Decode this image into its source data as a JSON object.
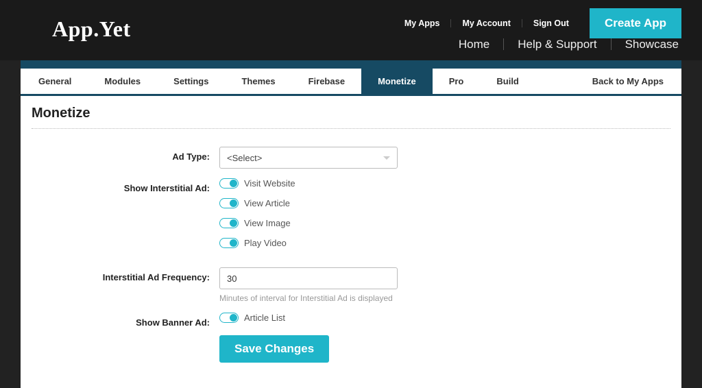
{
  "logo": "App.Yet",
  "top_links": {
    "my_apps": "My Apps",
    "my_account": "My Account",
    "sign_out": "Sign Out"
  },
  "create_app": "Create App",
  "main_nav": {
    "home": "Home",
    "help": "Help & Support",
    "showcase": "Showcase"
  },
  "tabs": {
    "general": "General",
    "modules": "Modules",
    "settings": "Settings",
    "themes": "Themes",
    "firebase": "Firebase",
    "monetize": "Monetize",
    "pro": "Pro",
    "build": "Build",
    "back": "Back to My Apps"
  },
  "page_title": "Monetize",
  "form": {
    "ad_type": {
      "label": "Ad Type:",
      "value": "<Select>"
    },
    "show_interstitial": {
      "label": "Show Interstitial Ad:",
      "options": {
        "visit_website": "Visit Website",
        "view_article": "View Article",
        "view_image": "View Image",
        "play_video": "Play Video"
      }
    },
    "frequency": {
      "label": "Interstitial Ad Frequency:",
      "value": "30",
      "helper": "Minutes of interval for Interstitial Ad is displayed"
    },
    "show_banner": {
      "label": "Show Banner Ad:",
      "options": {
        "article_list": "Article List"
      }
    },
    "save": "Save Changes"
  }
}
